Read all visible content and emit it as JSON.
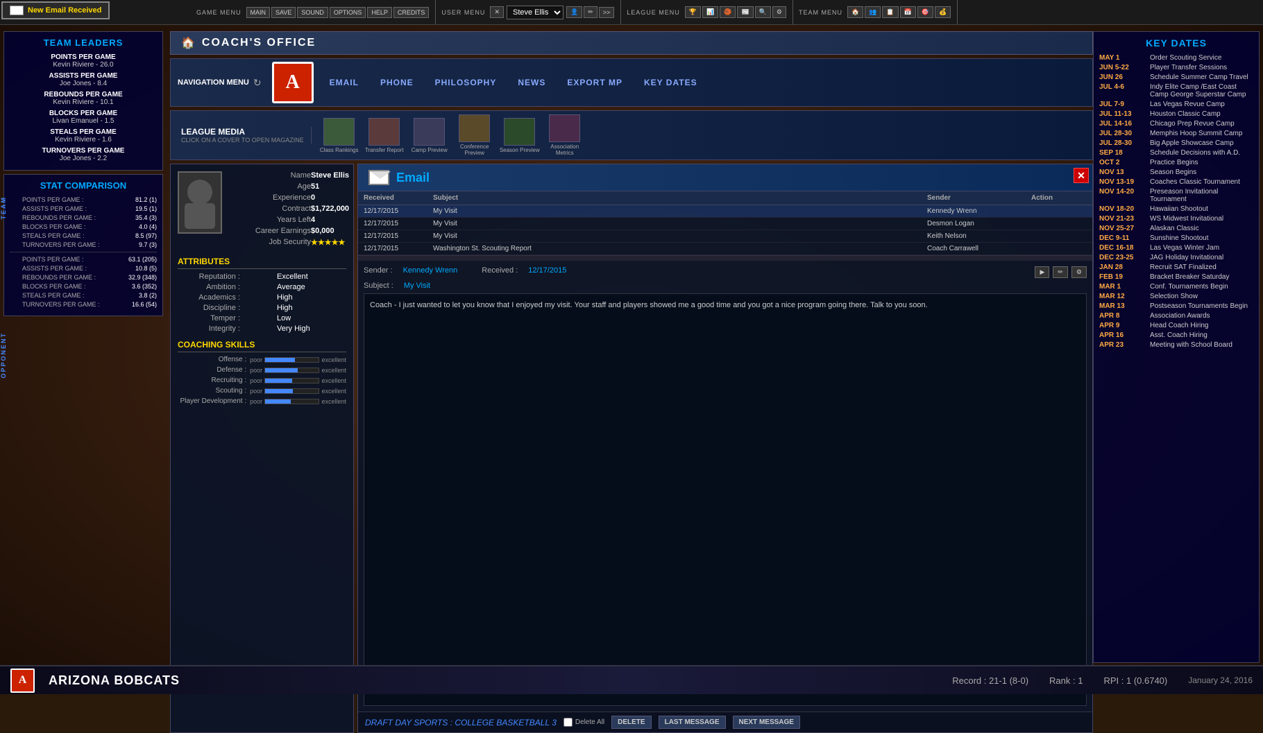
{
  "topMenu": {
    "game": {
      "title": "GAME MENU",
      "items": [
        "MAIN",
        "SAVE",
        "SOUND",
        "OPTIONS",
        "HELP",
        "CREDITS"
      ]
    },
    "user": {
      "title": "USER MENU",
      "name": "Steve Ellis"
    },
    "league": {
      "title": "LEAGUE MENU"
    },
    "team": {
      "title": "TEAM MENU"
    }
  },
  "emailNotification": {
    "text": "New Email Received"
  },
  "leftPanel": {
    "teamLeaders": {
      "title": "TEAM LEADERS",
      "categories": [
        {
          "label": "POINTS PER GAME",
          "leader": "Kevin Riviere - 26.0"
        },
        {
          "label": "ASSISTS PER GAME",
          "leader": "Joe Jones - 8.4"
        },
        {
          "label": "REBOUNDS PER GAME",
          "leader": "Kevin Riviere - 10.1"
        },
        {
          "label": "BLOCKS PER GAME",
          "leader": "Livan Emanuel - 1.5"
        },
        {
          "label": "STEALS PER GAME",
          "leader": "Kevin Riviere - 1.6"
        },
        {
          "label": "TURNOVERS PER GAME",
          "leader": "Joe Jones - 2.2"
        }
      ]
    },
    "statComparison": {
      "title": "STAT COMPARISON",
      "teamLabel": "T E A M",
      "opponentLabel": "O P P O N E N T",
      "teamStats": [
        {
          "label": "POINTS PER GAME :",
          "value": "81.2 (1)"
        },
        {
          "label": "ASSISTS PER GAME :",
          "value": "19.5 (1)"
        },
        {
          "label": "REBOUNDS PER GAME :",
          "value": "35.4 (3)"
        },
        {
          "label": "BLOCKS PER GAME :",
          "value": "4.0 (4)"
        },
        {
          "label": "STEALS PER GAME :",
          "value": "8.5 (97)"
        },
        {
          "label": "TURNOVERS PER GAME :",
          "value": "9.7 (3)"
        }
      ],
      "oppStats": [
        {
          "label": "POINTS PER GAME :",
          "value": "63.1 (205)"
        },
        {
          "label": "ASSISTS PER GAME :",
          "value": "10.8 (5)"
        },
        {
          "label": "REBOUNDS PER GAME :",
          "value": "32.9 (348)"
        },
        {
          "label": "BLOCKS PER GAME :",
          "value": "3.6 (352)"
        },
        {
          "label": "STEALS PER GAME :",
          "value": "3.8 (2)"
        },
        {
          "label": "TURNOVERS PER GAME :",
          "value": "16.6 (54)"
        }
      ]
    }
  },
  "coachsOffice": {
    "title": "COACH'S OFFICE",
    "navTitle": "NAVIGATION MENU",
    "navItems": [
      "EMAIL",
      "PHONE",
      "PHILOSOPHY",
      "NEWS",
      "EXPORT MP",
      "KEY DATES"
    ],
    "leagueMedia": {
      "title": "LEAGUE MEDIA",
      "subtitle": "Click on a cover to open magazine",
      "items": [
        {
          "label": "Class Rankings"
        },
        {
          "label": "Transfer Report"
        },
        {
          "label": "Camp Preview"
        },
        {
          "label": "Conference Preview"
        },
        {
          "label": "Season Preview"
        },
        {
          "label": "Association Metrics"
        }
      ]
    }
  },
  "coachProfile": {
    "name": "Steve Ellis",
    "age": "51",
    "experience": "0",
    "contract": "$1,722,000",
    "yearsLeft": "4",
    "careerEarnings": "$0,000",
    "jobSecurity": "★★★★★",
    "attributes": {
      "title": "ATTRIBUTES",
      "items": [
        {
          "label": "Reputation :",
          "value": "Excellent"
        },
        {
          "label": "Ambition :",
          "value": "Average"
        },
        {
          "label": "Academics :",
          "value": "High"
        },
        {
          "label": "Discipline :",
          "value": "High"
        },
        {
          "label": "Temper :",
          "value": "Low"
        },
        {
          "label": "Integrity :",
          "value": "Very High"
        }
      ]
    },
    "coachingSkills": {
      "title": "COACHING SKILLS",
      "items": [
        {
          "label": "Offense :",
          "poor": "poor",
          "excellent": "excellent",
          "fill": 55
        },
        {
          "label": "Defense :",
          "poor": "poor",
          "excellent": "excellent",
          "fill": 60
        },
        {
          "label": "Recruiting :",
          "poor": "poor",
          "excellent": "excellent",
          "fill": 50
        },
        {
          "label": "Scouting :",
          "poor": "poor",
          "excellent": "excellent",
          "fill": 52
        },
        {
          "label": "Player Development :",
          "poor": "poor",
          "excellent": "excellent",
          "fill": 48
        }
      ]
    }
  },
  "email": {
    "title": "Email",
    "columns": [
      "Received",
      "Subject",
      "",
      "Sender",
      "Action"
    ],
    "messages": [
      {
        "received": "12/17/2015",
        "subject": "My Visit",
        "sender": "Kennedy Wrenn",
        "selected": true
      },
      {
        "received": "12/17/2015",
        "subject": "My Visit",
        "sender": "Desmon Logan",
        "selected": false
      },
      {
        "received": "12/17/2015",
        "subject": "My Visit",
        "sender": "Keith Nelson",
        "selected": false
      },
      {
        "received": "12/17/2015",
        "subject": "Washington St. Scouting Report",
        "sender": "Coach Carrawell",
        "selected": false
      }
    ],
    "detail": {
      "senderLabel": "Sender :",
      "sender": "Kennedy Wrenn",
      "receivedLabel": "Received :",
      "received": "12/17/2015",
      "subjectLabel": "Subject :",
      "subject": "My Visit",
      "body": "Coach - I just wanted to let you know that I enjoyed my visit. Your staff and players showed me a good time and you got a nice program going there. Talk to you soon."
    },
    "footer": {
      "gameTitle": "DRAFT DAY SPORTS : COLLEGE BASKETBALL 3",
      "deleteAllLabel": "Delete All",
      "deleteBtn": "DELETE",
      "lastMsgBtn": "LAST MESSAGE",
      "nextMsgBtn": "NEXT MESSAGE"
    }
  },
  "rightPanel": {
    "title": "KEY DATES",
    "dates": [
      {
        "date": "MAY 1",
        "event": "Order Scouting Service"
      },
      {
        "date": "JUN 5-22",
        "event": "Player Transfer Sessions"
      },
      {
        "date": "JUN 26",
        "event": "Schedule Summer Camp Travel"
      },
      {
        "date": "JUL 4-6",
        "event": "Indy Elite Camp /East Coast Camp George Superstar Camp"
      },
      {
        "date": "JUL 7-9",
        "event": "Las Vegas Revue Camp"
      },
      {
        "date": "JUL 11-13",
        "event": "Houston Classic Camp"
      },
      {
        "date": "JUL 14-16",
        "event": "Chicago Prep Revue Camp"
      },
      {
        "date": "JUL 28-30",
        "event": "Memphis Hoop Summit Camp"
      },
      {
        "date": "JUL 28-30",
        "event": "Big Apple Showcase Camp"
      },
      {
        "date": "SEP 18",
        "event": "Schedule Decisions with A.D."
      },
      {
        "date": "OCT 2",
        "event": "Practice Begins"
      },
      {
        "date": "NOV 13",
        "event": "Season Begins"
      },
      {
        "date": "NOV 13-19",
        "event": "Coaches Classic Tournament"
      },
      {
        "date": "NOV 14-20",
        "event": "Preseason Invitational Tournament"
      },
      {
        "date": "NOV 18-20",
        "event": "Hawaiian Shootout"
      },
      {
        "date": "NOV 21-23",
        "event": "WS Midwest Invitational"
      },
      {
        "date": "NOV 25-27",
        "event": "Alaskan Classic"
      },
      {
        "date": "DEC 9-11",
        "event": "Sunshine Shootout"
      },
      {
        "date": "DEC 16-18",
        "event": "Las Vegas Winter Jam"
      },
      {
        "date": "DEC 23-25",
        "event": "JAG Holiday Invitational"
      },
      {
        "date": "JAN 28",
        "event": "Recruit SAT Finalized"
      },
      {
        "date": "FEB 19",
        "event": "Bracket Breaker Saturday"
      },
      {
        "date": "MAR 1",
        "event": "Conf. Tournaments Begin"
      },
      {
        "date": "MAR 12",
        "event": "Selection Show"
      },
      {
        "date": "MAR 13",
        "event": "Postseason Tournaments Begin"
      },
      {
        "date": "APR 8",
        "event": "Association Awards"
      },
      {
        "date": "APR 9",
        "event": "Head Coach Hiring"
      },
      {
        "date": "APR 16",
        "event": "Asst. Coach Hiring"
      },
      {
        "date": "APR 23",
        "event": "Meeting with School Board"
      }
    ]
  },
  "bottomBar": {
    "teamName": "ARIZONA BOBCATS",
    "record": "Record : 21-1 (8-0)",
    "rank": "Rank : 1",
    "rpi": "RPI : 1 (0.6740)",
    "date": "January 24, 2016"
  },
  "teamLogo": "A"
}
